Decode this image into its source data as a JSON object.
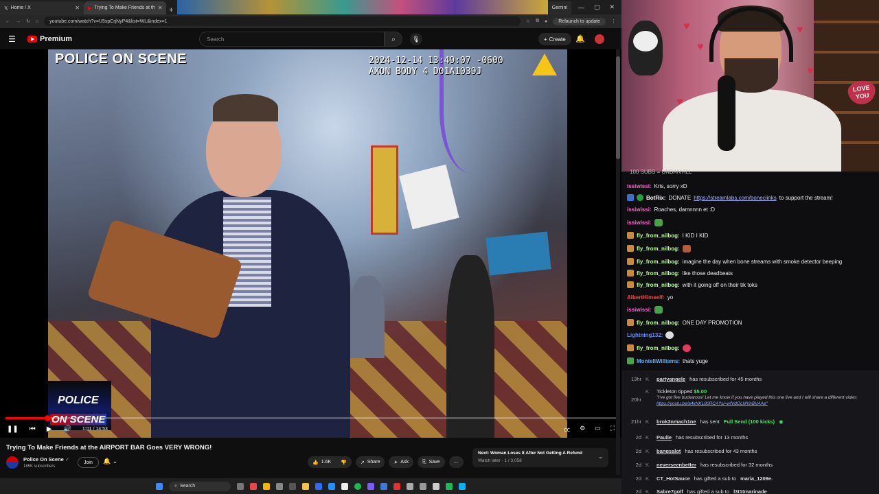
{
  "browser": {
    "tabs": [
      {
        "label": "Home / X"
      },
      {
        "label": "Trying To Make Friends at th"
      }
    ],
    "gemini_tab": "Gemini",
    "url": "youtube.com/watch?v=U5spCrjNyP4&list=WL&index=1",
    "relaunch_label": "Relaunch to update"
  },
  "youtube": {
    "brand": "Premium",
    "search_placeholder": "Search",
    "create_label": "Create"
  },
  "video": {
    "overlay_title": "POLICE ON SCENE",
    "timestamp_line1": "2024-12-14 13:49:07 -0600",
    "timestamp_line2": "AXON BODY 4 D01A1039J",
    "badge_top": "POLICE",
    "badge_bottom": "ON SCENE",
    "timecode": "1:01 / 14:53",
    "progress": 0.068,
    "title": "Trying To Make Friends at the AIRPORT BAR Goes VERY WRONG!",
    "channel": "Police On Scene",
    "subscribers": "185K subscribers",
    "join_label": "Join",
    "likes": "1.6K",
    "share_label": "Share",
    "ask_label": "Ask",
    "save_label": "Save",
    "next_title": "Next: Woman Loses It After Not Getting A Refund",
    "next_sub": "Watch later · 1 / 3,058"
  },
  "taskbar": {
    "search_label": "Search"
  },
  "webcam": {
    "sign_line1": "LOVE",
    "sign_line2": "YOU"
  },
  "chat": {
    "goal": "100 SUBS = UNBAN ALL",
    "messages": [
      {
        "user": "issiwissi:",
        "text": "Kris, sorry xD",
        "color": "#ff5fd2"
      },
      {
        "user": "BotRix:",
        "text": "DONATE",
        "link": "https://streamlabs.com/boneclinks",
        "text2": "to support the stream!",
        "color": "#ffffff"
      },
      {
        "user": "issiwissi:",
        "text": "Roaches, damnnnn et :D",
        "color": "#ff5fd2"
      },
      {
        "user": "issiwissi:",
        "text": "",
        "color": "#ff5fd2"
      },
      {
        "user": "fly_from_nilbog:",
        "text": "I KID I KID",
        "color": "#b8ff9a"
      },
      {
        "user": "fly_from_nilbog:",
        "text": "",
        "color": "#b8ff9a"
      },
      {
        "user": "fly_from_nilbog:",
        "text": "imagine the day when bone streams with smoke detector beeping",
        "color": "#b8ff9a"
      },
      {
        "user": "fly_from_nilbog:",
        "text": "like those deadbeats",
        "color": "#b8ff9a"
      },
      {
        "user": "fly_from_nilbog:",
        "text": "with it going off on their tik toks",
        "color": "#b8ff9a"
      },
      {
        "user": "AlbertHimself:",
        "text": "yo",
        "color": "#ff4040"
      },
      {
        "user": "issiwissi:",
        "text": "",
        "color": "#ff5fd2"
      },
      {
        "user": "fly_from_nilbog:",
        "text": "ONE DAY PROMOTION",
        "color": "#b8ff9a"
      },
      {
        "user": "Lightning132:",
        "text": "",
        "color": "#5b8cff"
      },
      {
        "user": "fly_from_nilbog:",
        "text": "",
        "color": "#b8ff9a"
      },
      {
        "user": "MontellWilliams:",
        "text": "thats yuge",
        "color": "#5fb0ff"
      }
    ]
  },
  "events": [
    {
      "time": "13hr",
      "user": "partyangele",
      "text": "has resubscribed for 45 months"
    },
    {
      "time": "20hr",
      "user": "Tickleton",
      "text": "tipped",
      "amount": "$5.00",
      "message": "\"I've got five buckaroos! Let me know if you have played this one live and I will share a different video:",
      "message_link": "https://youtu.be/a4kNKL80RCA?si=wfVdOLMVnBVAAe\""
    },
    {
      "time": "21hr",
      "user": "brok3nmach1ne",
      "text": "has sent",
      "amount": "Full Send (100 kicks)"
    },
    {
      "time": "2d",
      "user": "Paulie",
      "text": "has resubscribed for 13 months"
    },
    {
      "time": "2d",
      "user": "bangsalot",
      "text": "has resubscribed for 43 months"
    },
    {
      "time": "2d",
      "user": "neverseenbetter",
      "text": "has resubscribed for 32 months"
    },
    {
      "time": "2d",
      "user": "CT_HotSauce",
      "text": "has gifted a sub to",
      "target": "maria_1209e."
    },
    {
      "time": "2d",
      "user": "Sabre7golf",
      "text": "has gifted a sub to",
      "target": "l3t1tmarinade"
    }
  ]
}
